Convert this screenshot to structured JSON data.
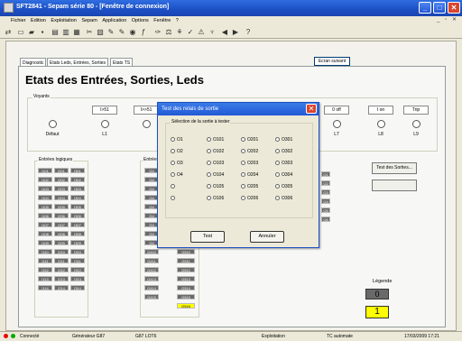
{
  "window": {
    "title": "SFT2841 - Sepam série 80 - [Fenêtre de connexion]",
    "min": "_",
    "max": "□",
    "close": "✕"
  },
  "menu": [
    "Fichier",
    "Edition",
    "Exploitation",
    "Sepam",
    "Application",
    "Options",
    "Fenêtre",
    "?"
  ],
  "mdi_controls": "_ ▫ ✕",
  "toolbar": {
    "icons": [
      "toolbar-icon"
    ],
    "screen_button": "Ecran suivant"
  },
  "tabs": [
    "Diagnostic",
    "Etats Leds, Entrées, Sorties",
    "Etats TS"
  ],
  "page_title": "Etats des Entrées, Sorties, Leds",
  "voyants": {
    "label": "Voyants",
    "columns": [
      {
        "hdr": "",
        "lbl": "Défaut"
      },
      {
        "hdr": "I>51",
        "lbl": "L1"
      },
      {
        "hdr": "I>>51",
        "lbl": ""
      },
      {
        "hdr": "",
        "lbl": ""
      },
      {
        "hdr": "",
        "lbl": ""
      },
      {
        "hdr": "",
        "lbl": ""
      },
      {
        "hdr": "",
        "lbl": ""
      },
      {
        "hdr": "0 off",
        "lbl": "L7"
      },
      {
        "hdr": "I on",
        "lbl": "L8"
      },
      {
        "hdr": "Trip",
        "lbl": "L9"
      }
    ]
  },
  "entrees": {
    "label": "Entrées logiques",
    "col1": [
      "I101",
      "I102",
      "I103",
      "I104",
      "I105",
      "I106",
      "I107",
      "I108",
      "I109",
      "I110",
      "I111",
      "I112",
      "I113",
      "I114"
    ],
    "col2": [
      "I201",
      "I202",
      "I203",
      "I204",
      "I205",
      "I206",
      "I207",
      "I208",
      "I209",
      "I210",
      "I211",
      "I212",
      "I213",
      "I214"
    ],
    "col3": [
      "I301",
      "I302",
      "I303",
      "I304",
      "I305",
      "I306",
      "I307",
      "I308",
      "I309",
      "I310",
      "I311",
      "I312",
      "I313",
      "I314"
    ]
  },
  "entrees2": {
    "label": "Entrées",
    "col1": [
      "G4",
      "G4",
      "G4",
      "G4",
      "G4",
      "G4",
      "G4",
      "G4",
      "G4",
      "G410",
      "G411",
      "G412",
      "G413",
      "G414",
      "G415"
    ],
    "col2": [
      "",
      "",
      "",
      "",
      "",
      "",
      "",
      "",
      "",
      "G510",
      "G511",
      "G512",
      "G513",
      "G514",
      "G515",
      "G516"
    ]
  },
  "right_cells": [
    "O1",
    "O2",
    "O3",
    "O4",
    "O5",
    "O6"
  ],
  "test_sorties_button": "Test des Sorties...",
  "legend": {
    "label": "Légende",
    "zero": "0",
    "one": "1"
  },
  "status": [
    "Connecté",
    "Générateur G87",
    "G87 LOT6",
    "Exploitation",
    "TC automate",
    "17/03/2009 17:21"
  ],
  "dialog": {
    "title": "Test des relais de sortie",
    "close": "✕",
    "group_label": "Sélection de la sortie à tester",
    "options": [
      [
        "O1",
        "O101",
        "O201",
        "O301"
      ],
      [
        "O2",
        "O102",
        "O202",
        "O302"
      ],
      [
        "O3",
        "O103",
        "O203",
        "O303"
      ],
      [
        "O4",
        "O104",
        "O204",
        "O304"
      ],
      [
        "",
        "O105",
        "O205",
        "O305"
      ],
      [
        "",
        "O106",
        "O206",
        "O306"
      ]
    ],
    "test": "Test",
    "cancel": "Annuler"
  }
}
